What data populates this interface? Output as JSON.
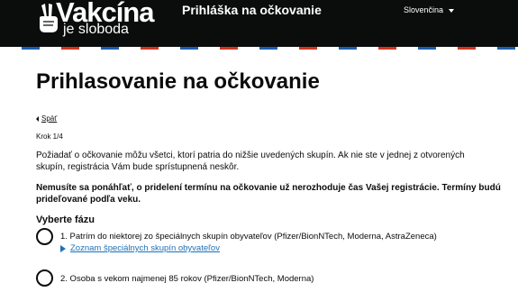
{
  "header": {
    "logo_main": "Vakcína",
    "logo_sub": "je sloboda",
    "app_title": "Prihláška na očkovanie",
    "language": "Slovenčina"
  },
  "main": {
    "title": "Prihlasovanie na očkovanie",
    "back_label": "Späť",
    "step_label": "Krok 1/4",
    "intro": "Požiadať o očkovanie môžu všetci, ktorí patria do nižšie uvedených skupín. Ak nie ste v jednej z otvorených skupín, registrácia Vám bude sprístupnená neskôr.",
    "notice": "Nemusíte sa ponáhľať, o pridelení termínu na očkovanie už nerozhoduje čas Vašej registrácie. Termíny budú prideľované podľa veku.",
    "phase_legend": "Vyberte fázu",
    "options": [
      {
        "label": "1. Patrím do niektorej zo špeciálnych skupín obyvateľov (Pfizer/BionNTech, Moderna, AstraZeneca)",
        "details_link": "Zoznam špeciálnych skupín obyvateľov"
      },
      {
        "label": "2. Osoba s vekom najmenej 85 rokov (Pfizer/BionNTech, Moderna)"
      }
    ]
  },
  "colors": {
    "header_bg": "#0b0c0c",
    "link": "#1d70b8",
    "stripe_blue": "#1a5fb4",
    "stripe_red": "#d4351c"
  },
  "icons": {
    "logo": "victory-hand-icon",
    "language": "caret-down-icon",
    "back": "chevron-left-icon",
    "details": "triangle-right-icon"
  }
}
